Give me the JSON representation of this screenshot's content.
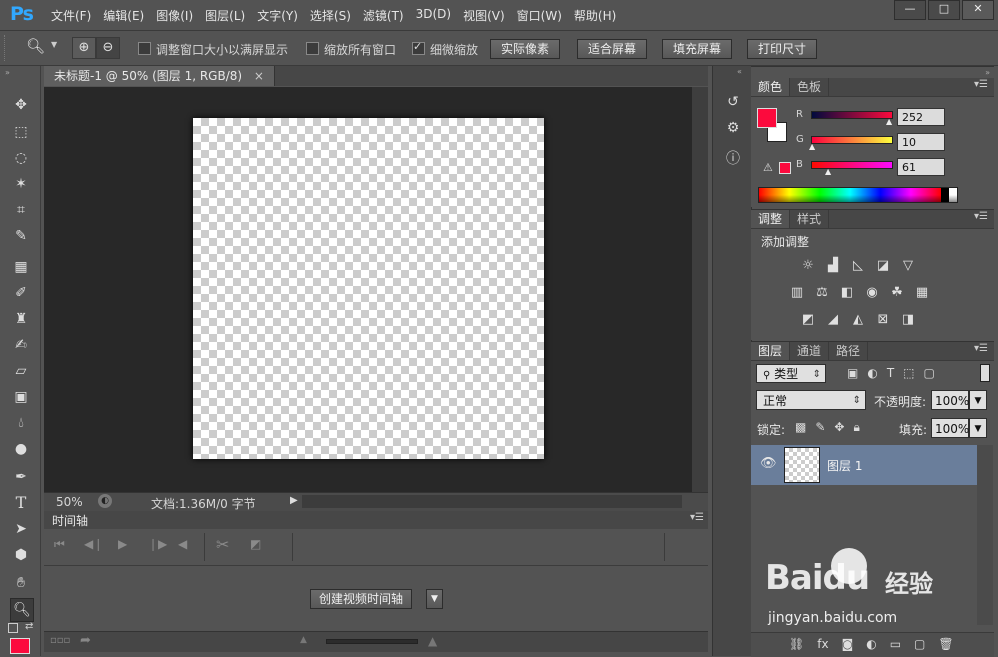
{
  "app": {
    "logo": "Ps"
  },
  "menu": [
    "文件(F)",
    "编辑(E)",
    "图像(I)",
    "图层(L)",
    "文字(Y)",
    "选择(S)",
    "滤镜(T)",
    "3D(D)",
    "视图(V)",
    "窗口(W)",
    "帮助(H)"
  ],
  "window_controls": {
    "minimize": "—",
    "maximize": "□",
    "close": "✕"
  },
  "options": {
    "resize_windows": "调整窗口大小以满屏显示",
    "zoom_all": "缩放所有窗口",
    "scrubby_zoom": "细微缩放",
    "actual_pixels": "实际像素",
    "fit_screen": "适合屏幕",
    "fill_screen": "填充屏幕",
    "print_size": "打印尺寸"
  },
  "document": {
    "tab_title": "未标题-1 @ 50% (图层 1, RGB/8)",
    "zoom": "50%",
    "doc_info": "文档:1.36M/0 字节"
  },
  "timeline": {
    "title": "时间轴",
    "create_button": "创建视频时间轴"
  },
  "color_panel": {
    "tabs": [
      "颜色",
      "色板"
    ],
    "r_label": "R",
    "g_label": "G",
    "b_label": "B",
    "r": "252",
    "g": "10",
    "b": "61",
    "foreground_color": "#fc0a3d",
    "background_color": "#ffffff"
  },
  "adjust_panel": {
    "tabs": [
      "调整",
      "样式"
    ],
    "title": "添加调整"
  },
  "layers_panel": {
    "tabs": [
      "图层",
      "通道",
      "路径"
    ],
    "filter_kind": "类型",
    "blend_mode": "正常",
    "opacity_label": "不透明度:",
    "opacity": "100%",
    "lock_label": "锁定:",
    "fill_label": "填充:",
    "fill": "100%",
    "layers": [
      {
        "name": "图层 1",
        "visible": true
      }
    ]
  },
  "watermark": {
    "brand": "Baidu",
    "cn": "经验",
    "url": "jingyan.baidu.com"
  }
}
